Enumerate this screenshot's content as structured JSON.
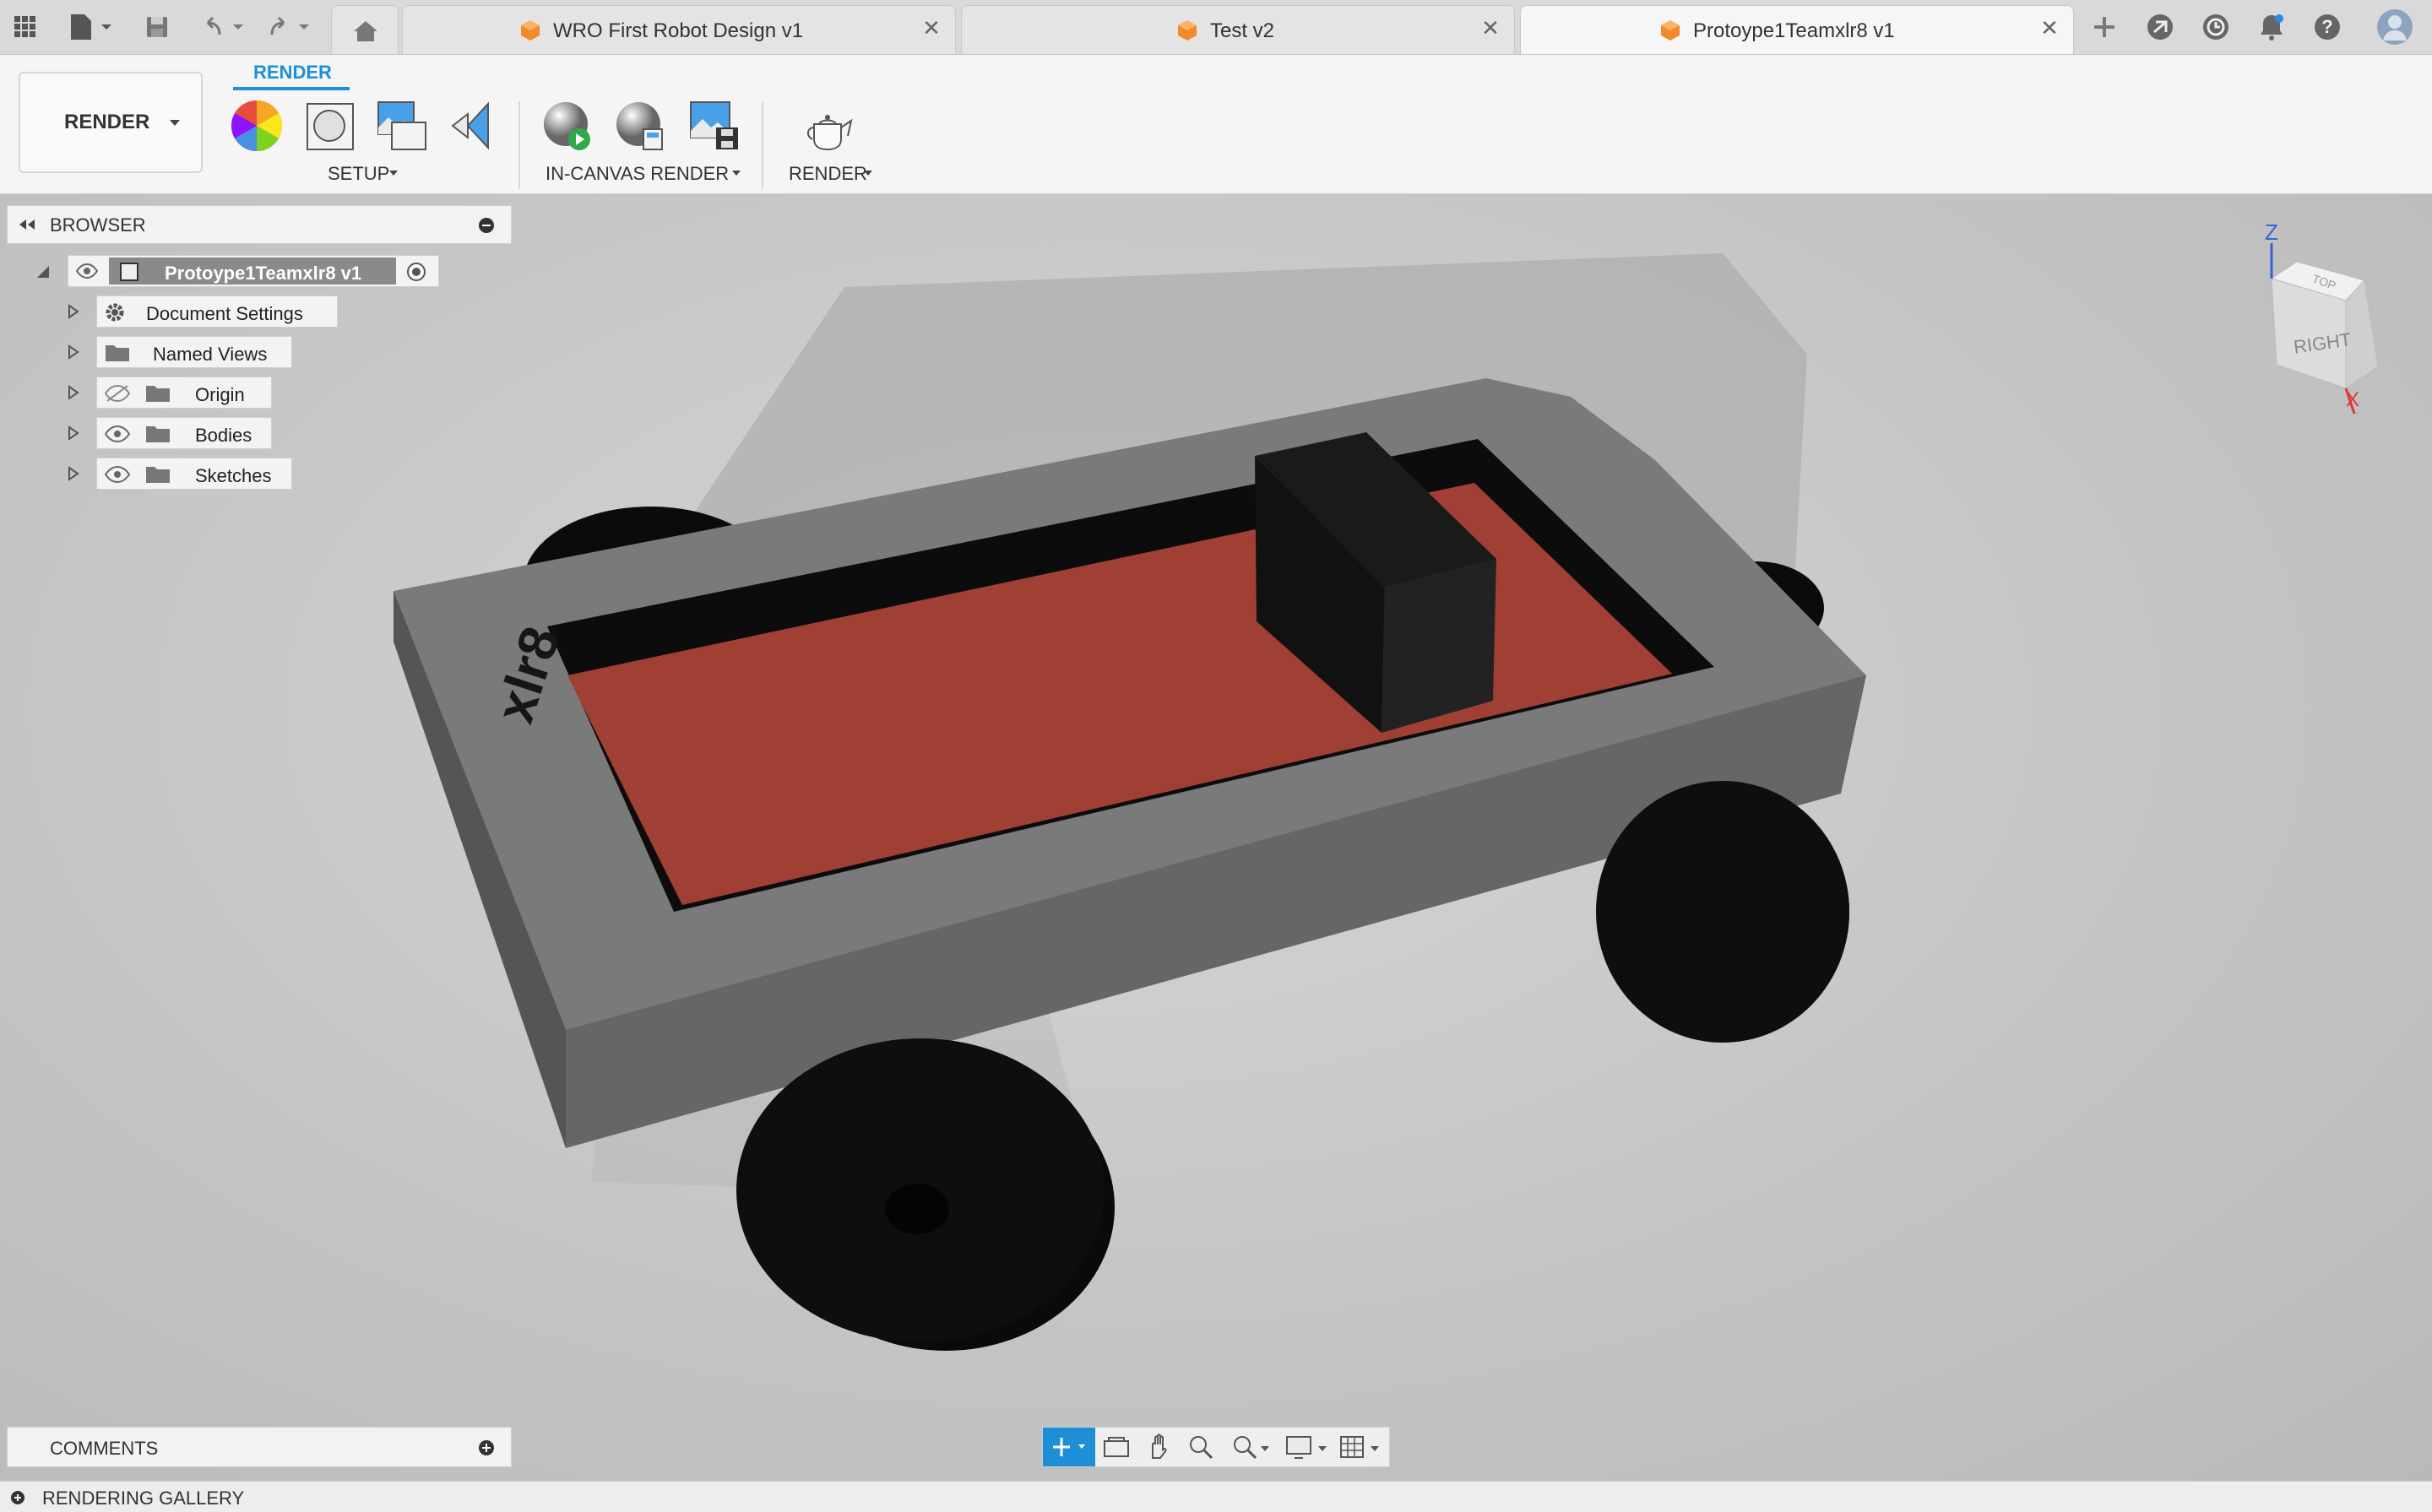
{
  "tabs": [
    {
      "label": "WRO First Robot Design v1",
      "active": false
    },
    {
      "label": "Test v2",
      "active": false
    },
    {
      "label": "Protoype1Teamxlr8 v1",
      "active": true
    }
  ],
  "toolbar": {
    "workspace": "RENDER",
    "active_tab": "RENDER",
    "groups": {
      "setup": "SETUP",
      "in_canvas": "IN-CANVAS RENDER",
      "render": "RENDER"
    }
  },
  "browser": {
    "title": "BROWSER",
    "root": "Protoype1Teamxlr8 v1",
    "items": [
      "Document Settings",
      "Named Views",
      "Origin",
      "Bodies",
      "Sketches"
    ]
  },
  "model": {
    "label": "xlr8",
    "accent": "#993a30"
  },
  "viewcube": {
    "face_right": "RIGHT",
    "face_top": "TOP",
    "axis_z": "Z",
    "axis_x": "X"
  },
  "comments": {
    "title": "COMMENTS"
  },
  "gallery": {
    "title": "RENDERING GALLERY"
  },
  "colors": {
    "accent": "#1e8fd6",
    "tab_active": "#f6f6f6"
  }
}
